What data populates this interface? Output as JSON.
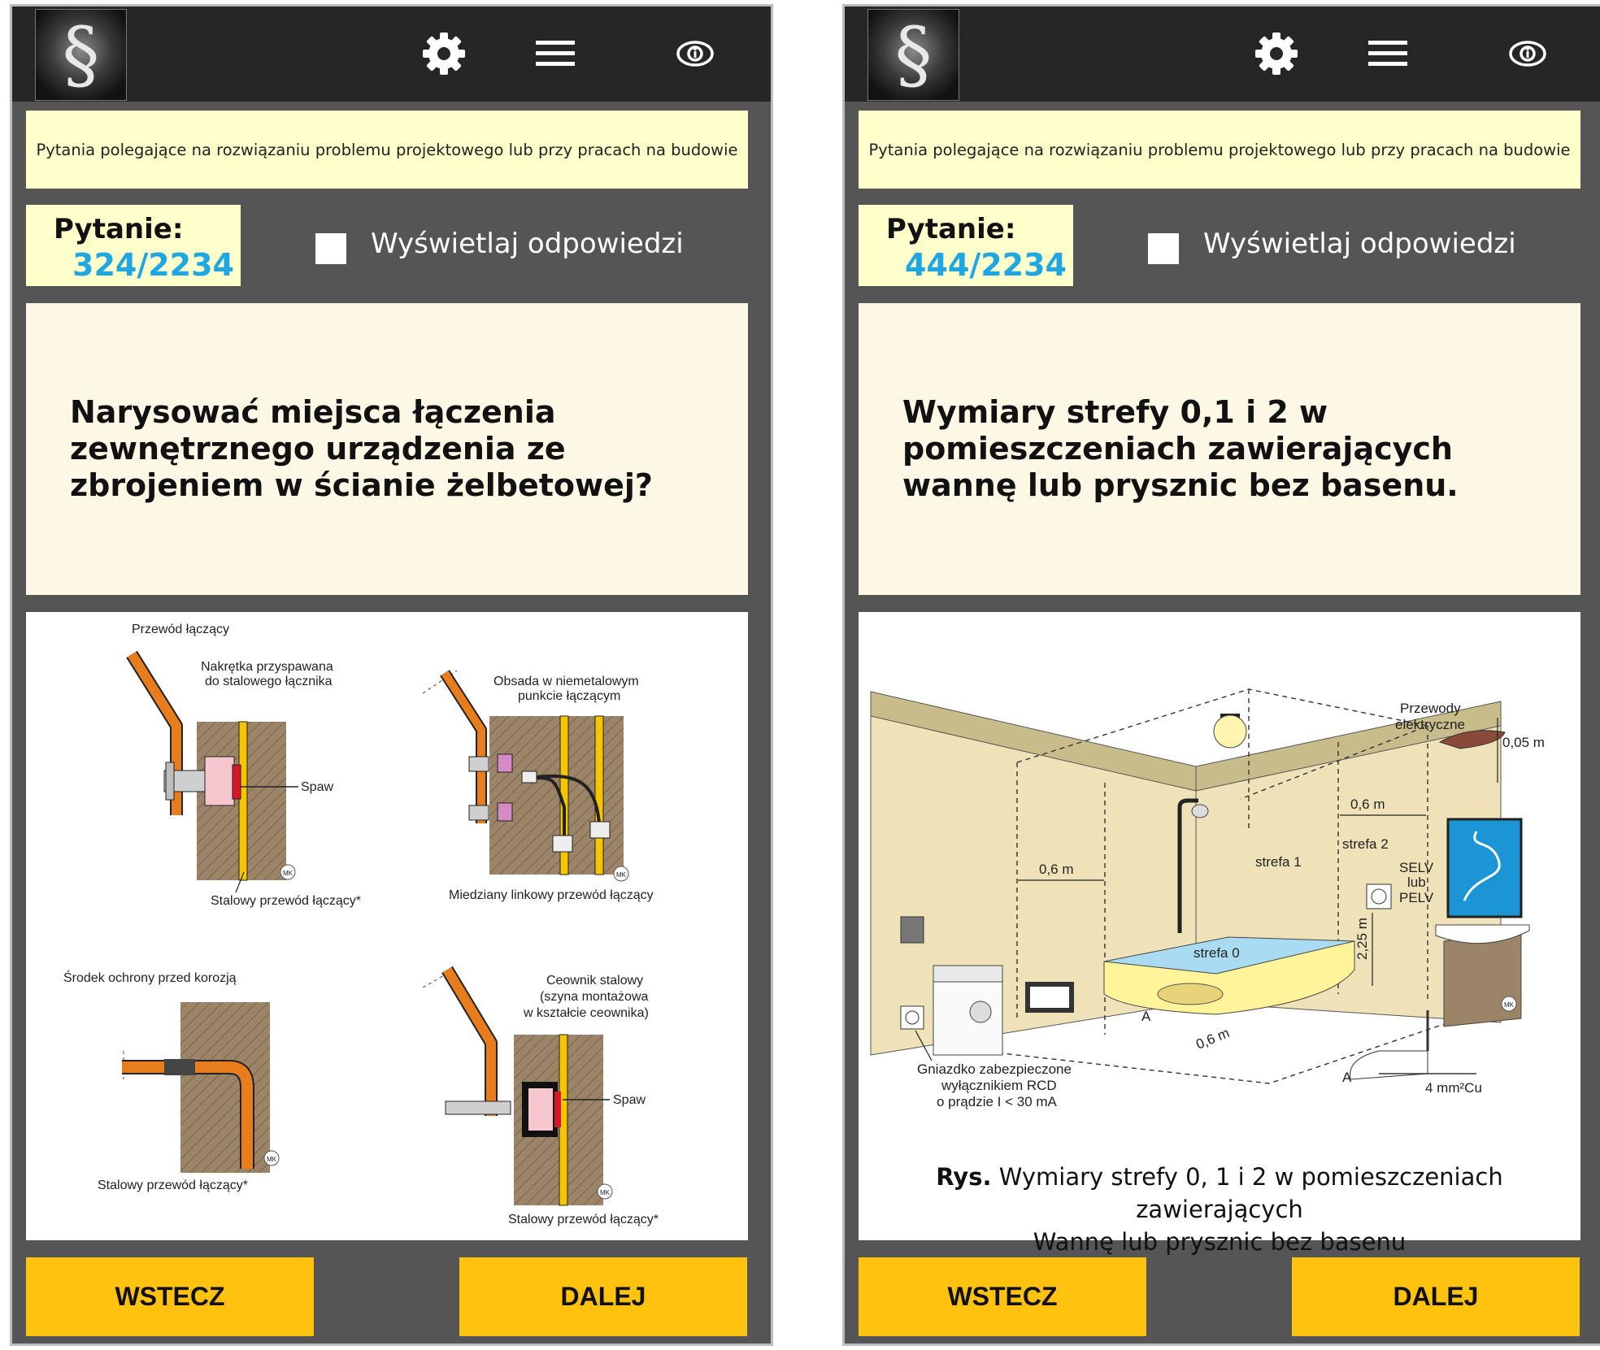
{
  "app": {
    "logo_glyph": "§",
    "icons": [
      "gear-icon",
      "hamburger-menu-icon",
      "info-icon"
    ],
    "colors": {
      "topbar": "#262626",
      "background": "#555555",
      "banner": "#ffffcc",
      "question_bg": "#fdf7e6",
      "question_number": "#1ea7e0",
      "button": "#ffc20e"
    }
  },
  "left": {
    "banner": "Pytania polegające na rozwiązaniu problemu projektowego lub przy pracach na budowie",
    "question_label": "Pytanie:",
    "question_number": "324/2234",
    "show_answers_label": "Wyświetlaj odpowiedzi",
    "question_text": "Narysować miejsca łączenia zewnętrznego urządzenia ze zbrojeniem w ścianie żelbetowej?",
    "figure": {
      "labels": {
        "p1_top": "Przewód łączący",
        "p1_nut_1": "Nakrętka przyspawana",
        "p1_nut_2": "do stalowego łącznika",
        "p1_weld": "Spaw",
        "p1_bottom": "Stalowy przewód łączący*",
        "p2_top_1": "Obsada w niemetalowym",
        "p2_top_2": "punkcie łączącym",
        "p2_bottom": "Miedziany linkowy przewód łączący",
        "p3_top": "Środek ochrony przed korozją",
        "p3_bottom": "Stalowy przewód łączący*",
        "p4_top_1": "Ceownik stalowy",
        "p4_top_2": "(szyna montażowa",
        "p4_top_3": "w kształcie ceownika)",
        "p4_weld": "Spaw",
        "p4_bottom": "Stalowy przewód łączący*",
        "mark": "MK"
      }
    },
    "back_label": "WSTECZ",
    "next_label": "DALEJ"
  },
  "right": {
    "banner": "Pytania polegające na rozwiązaniu problemu projektowego lub przy pracach na budowie",
    "question_label": "Pytanie:",
    "question_number": "444/2234",
    "show_answers_label": "Wyświetlaj odpowiedzi",
    "question_text": "Wymiary strefy 0,1 i 2 w pomieszczeniach zawierających wannę lub prysznic bez basenu.",
    "figure": {
      "labels": {
        "wires_1": "Przewody",
        "wires_2": "elektryczne",
        "dim_005": "0,05 m",
        "dim_06_top": "0,6 m",
        "dim_06_left": "0,6 m",
        "dim_06_floor": "0,6 m",
        "dim_225": "2,25 m",
        "zone0": "strefa 0",
        "zone1": "strefa 1",
        "zone2": "strefa 2",
        "selv_1": "SELV",
        "selv_2": "lub",
        "selv_3": "PELV",
        "socket_1": "Gniazdko zabezpieczone",
        "socket_2": "wyłącznikiem RCD",
        "socket_3": "o prądzie I < 30 mA",
        "point_a1": "A",
        "point_a2": "A",
        "copper": "4 mm²Cu",
        "mark": "MK"
      },
      "caption_bold": "Rys.",
      "caption_line1": "Wymiary strefy 0, 1 i 2 w pomieszczeniach zawierających",
      "caption_line2": "Wannę lub prysznic bez basenu"
    },
    "back_label": "WSTECZ",
    "next_label": "DALEJ"
  }
}
